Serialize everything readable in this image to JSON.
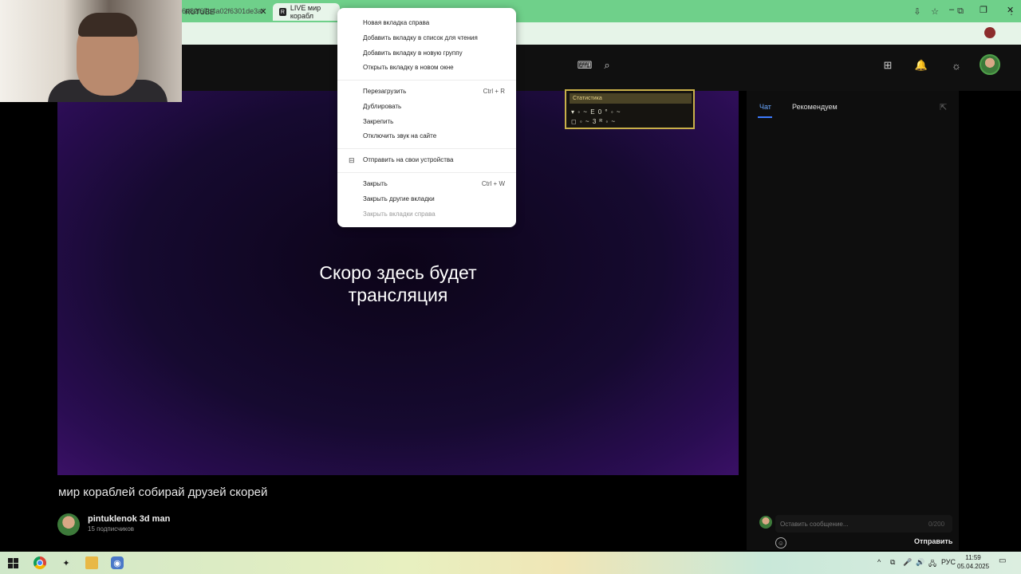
{
  "browser": {
    "tabs": [
      {
        "label": "RUTUBE"
      },
      {
        "label": "LIVE мир корабл"
      }
    ],
    "tab_close_glyph": "✕",
    "active_tab_favicon": "R",
    "url": "6d82f67b4a02f6301de3a/",
    "window_controls": [
      "–",
      "❐",
      "✕"
    ]
  },
  "site_header_icons": [
    "keyboard-icon",
    "search-icon",
    "add-icon",
    "bell-icon",
    "sun-icon"
  ],
  "player": {
    "message_line1": "Скоро здесь будет",
    "message_line2": "трансляция",
    "stats": {
      "title": "Статистика",
      "row1": "▾ ◦ ~ E 0 ° ◦ ~",
      "row2": "◻ ◦ ~ 3 ᴿ ◦ ~"
    }
  },
  "stream": {
    "title": "мир кораблей собирай друзей скорей",
    "channel_name": "pintuklenok 3d man",
    "subscribers": "15 подписчиков"
  },
  "chat": {
    "tabs": [
      "Чат",
      "Рекомендуем"
    ],
    "popout_glyph": "⇱",
    "input_placeholder": "Оставить сообщение...",
    "counter": "0/200",
    "emoji_glyph": "☺",
    "send_label": "Отправить"
  },
  "context_menu": {
    "items": [
      {
        "label": "Новая вкладка справа",
        "shortcut": ""
      },
      {
        "label": "Добавить вкладку в список для чтения",
        "shortcut": ""
      },
      {
        "label": "Добавить вкладку в новую группу",
        "shortcut": ""
      },
      {
        "label": "Открыть вкладку в новом окне",
        "shortcut": ""
      },
      {
        "label": "Перезагрузить",
        "shortcut": "Ctrl + R"
      },
      {
        "label": "Дублировать",
        "shortcut": ""
      },
      {
        "label": "Закрепить",
        "shortcut": ""
      },
      {
        "label": "Отключить звук на сайте",
        "shortcut": ""
      },
      {
        "label": "Отправить на свои устройства",
        "shortcut": ""
      },
      {
        "label": "Закрыть",
        "shortcut": "Ctrl + W"
      },
      {
        "label": "Закрыть другие вкладки",
        "shortcut": ""
      },
      {
        "label": "Закрыть вкладки справа",
        "shortcut": ""
      }
    ]
  },
  "taskbar": {
    "tray": [
      "^",
      "⧉",
      "🎤",
      "🔊",
      "🖧",
      "РУС"
    ],
    "time": "11:59",
    "date": "05.04.2025"
  }
}
